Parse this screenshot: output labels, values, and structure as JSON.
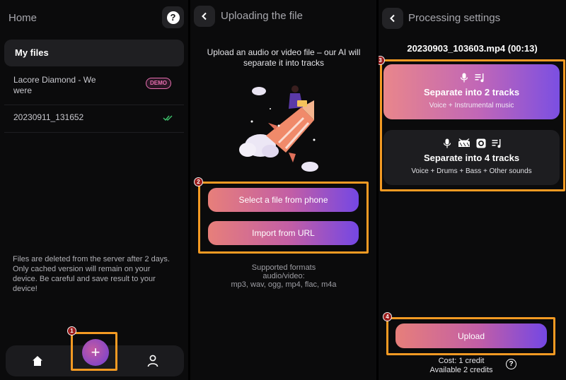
{
  "home_panel": {
    "title": "Home",
    "help_icon": "?",
    "my_files_label": "My files",
    "files": [
      {
        "name": "Lacore Diamond - We were",
        "badge": "DEMO"
      },
      {
        "name": "20230911_131652",
        "status_icon": "double-check-icon"
      }
    ],
    "note": "Files are deleted from the server after 2 days. Only cached version will remain on your device. Be careful and save result to your device!",
    "nav": {
      "home_icon": "home-icon",
      "add_label": "+",
      "profile_icon": "user-icon"
    }
  },
  "upload_panel": {
    "title": "Uploading the file",
    "intro": "Upload an audio or video file – our AI will separate it into tracks",
    "buttons": {
      "select_file": "Select a file from phone",
      "import_url": "Import from URL"
    },
    "formats_lines": [
      "Supported formats",
      "audio/video:",
      "mp3, wav, ogg, mp4, flac, m4a"
    ]
  },
  "settings_panel": {
    "title": "Processing settings",
    "file_name": "20230903_103603.mp4 (00:13)",
    "options": [
      {
        "title": "Separate into 2 tracks",
        "subtitle": "Voice + Instrumental music",
        "icons": [
          "mic-icon",
          "music-note-icon"
        ],
        "selected": true
      },
      {
        "title": "Separate into 4 tracks",
        "subtitle": "Voice + Drums + Bass + Other sounds",
        "icons": [
          "mic-icon",
          "drum-icon",
          "speaker-icon",
          "music-note-icon"
        ],
        "selected": false
      }
    ],
    "upload_label": "Upload",
    "cost": {
      "line1": "Cost: 1  credit",
      "line2": "Available 2 credits",
      "help_icon": "?"
    }
  },
  "markers": [
    "1",
    "2",
    "3",
    "4"
  ],
  "colors": {
    "highlight": "#f39a23",
    "marker_fill": "#9b1c1c",
    "gradient_start": "#e77f7a",
    "gradient_end": "#7447e4",
    "panel_bg": "#0b0b0c"
  }
}
